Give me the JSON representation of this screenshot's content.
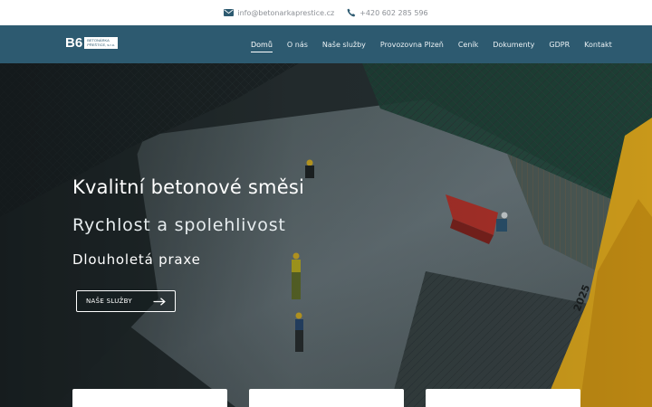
{
  "contact": {
    "email": "info@betonarkaprestice.cz",
    "phone": "+420 602 285 596",
    "email_icon": "envelope-icon",
    "phone_icon": "phone-icon"
  },
  "logo": {
    "mark": "B6",
    "line1": "BETONÁRKA",
    "line2": "PŘEŠTICE, s.r.o."
  },
  "nav": {
    "items": [
      "Domů",
      "O nás",
      "Naše služby",
      "Provozovna Plzeň",
      "Ceník",
      "Dokumenty",
      "GDPR",
      "Kontakt"
    ],
    "active": "Domů"
  },
  "hero": {
    "title": "Kvalitní betonové směsi",
    "subtitle": "Rychlost a spolehlivost",
    "subtitle2": "Dlouholetá praxe",
    "button_label": "NAŠE SLUŽBY",
    "button_icon": "arrow-right-icon",
    "crane_label": "2025"
  },
  "colors": {
    "nav_bg": "#2d5a70",
    "crane": "#f2b51c",
    "text_light": "#ffffff"
  }
}
